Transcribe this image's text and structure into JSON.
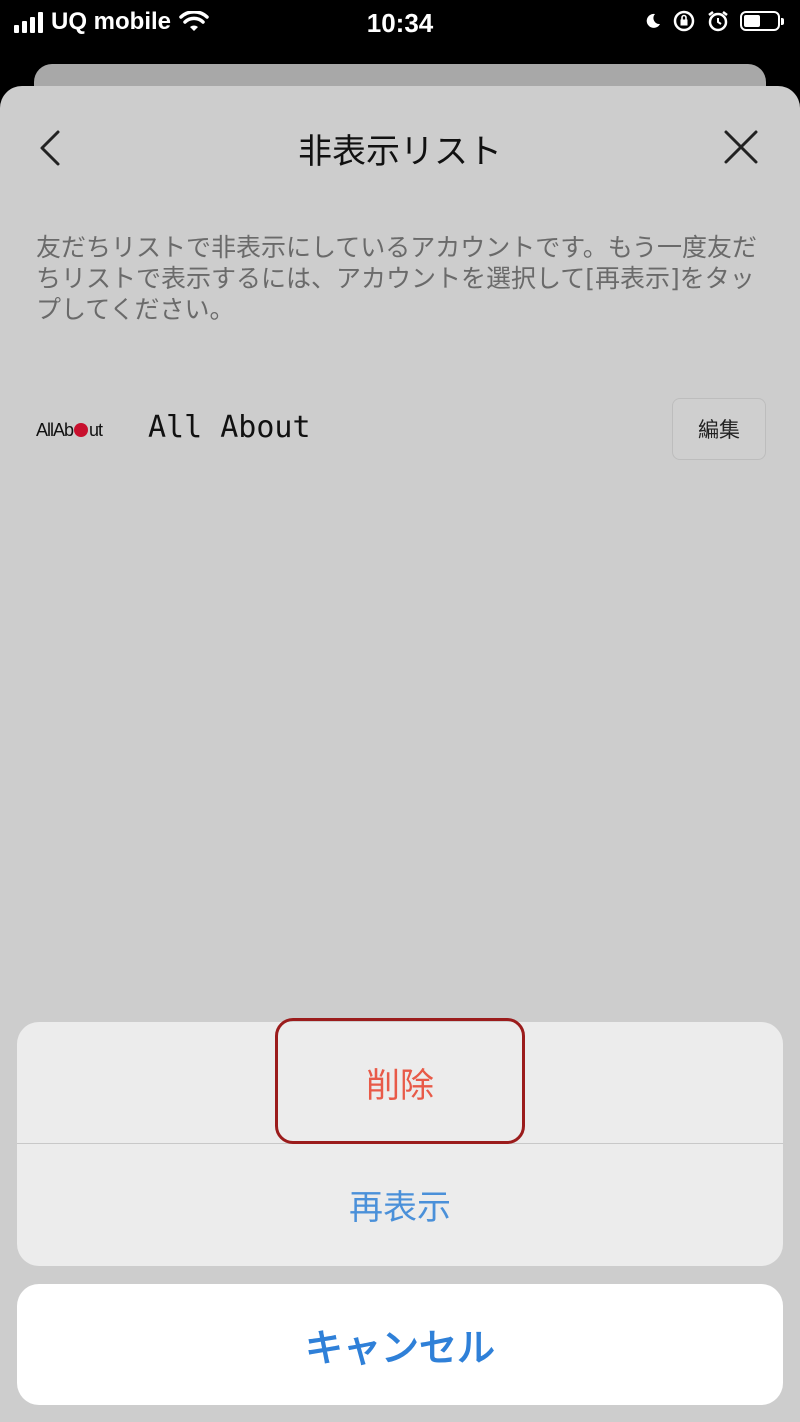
{
  "status_bar": {
    "carrier": "UQ mobile",
    "time": "10:34",
    "battery_level": 0.45
  },
  "header": {
    "title": "非表示リスト",
    "back_icon": "chevron-left-icon",
    "close_icon": "close-icon"
  },
  "description": "友だちリストで非表示にしているアカウントです。もう一度友だちリストで表示するには、アカウントを選択して[再表示]をタップしてください。",
  "account": {
    "logo_text_left": "AllAb",
    "logo_text_right": "ut",
    "logo_dot_color": "#c8102e",
    "name": "All About",
    "edit_label": "編集"
  },
  "action_sheet": {
    "delete_label": "削除",
    "redisplay_label": "再表示",
    "cancel_label": "キャンセル",
    "delete_color": "#e85a48",
    "redisplay_color": "#4a90d9",
    "cancel_color": "#2f80d8",
    "highlight_color": "#9b1c1c"
  }
}
